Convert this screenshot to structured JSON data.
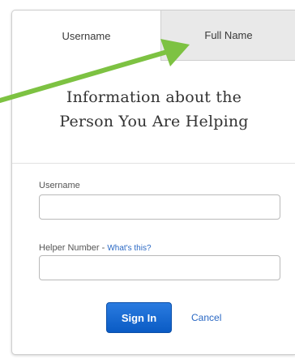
{
  "tabs": [
    {
      "label": "Username",
      "active": true
    },
    {
      "label": "Full Name",
      "active": false
    }
  ],
  "heading": {
    "line1": "Information about the",
    "line2": "Person You Are Helping"
  },
  "form": {
    "username": {
      "label": "Username",
      "value": "",
      "placeholder": ""
    },
    "helper_number": {
      "label": "Helper Number - ",
      "help_link": "What's this?",
      "value": "",
      "placeholder": ""
    }
  },
  "actions": {
    "sign_in_label": "Sign In",
    "cancel_label": "Cancel"
  },
  "colors": {
    "accent_blue": "#0a5bc4",
    "link_blue": "#2a68c4",
    "annotation_arrow": "#7dc242"
  }
}
